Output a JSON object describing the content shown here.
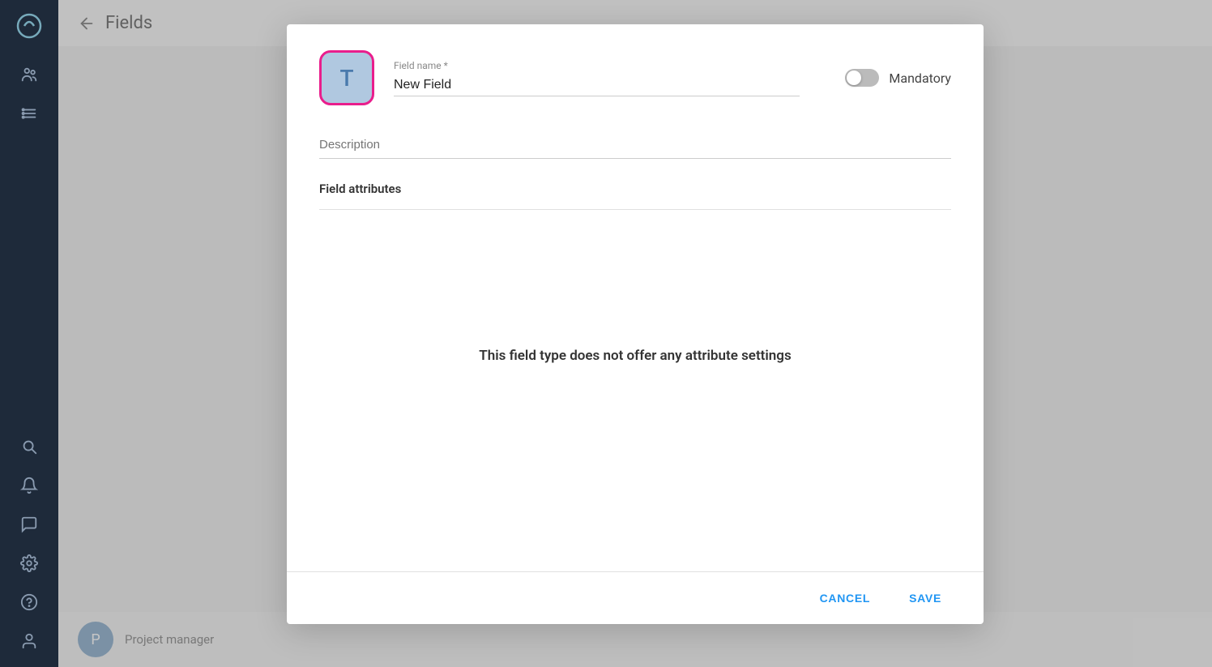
{
  "sidebar": {
    "logo_icon": "◑",
    "nav_top": [
      {
        "name": "users-icon",
        "icon": "👤",
        "unicode": "≡●"
      },
      {
        "name": "list-icon",
        "icon": "☰"
      }
    ],
    "nav_bottom": [
      {
        "name": "search-icon"
      },
      {
        "name": "bell-icon"
      },
      {
        "name": "chat-icon"
      },
      {
        "name": "settings-icon"
      },
      {
        "name": "help-icon"
      },
      {
        "name": "profile-icon"
      }
    ]
  },
  "page": {
    "back_label": "←",
    "title": "Fields"
  },
  "dialog": {
    "field_type_letter": "T",
    "field_name_label": "Field name *",
    "field_name_value": "New Field",
    "mandatory_label": "Mandatory",
    "description_placeholder": "Description",
    "field_attributes_label": "Field attributes",
    "no_attributes_message": "This field type does not offer any attribute settings",
    "cancel_label": "CANCEL",
    "save_label": "SAVE"
  },
  "bottom_item": {
    "avatar_letter": "P",
    "label": "Project manager"
  }
}
